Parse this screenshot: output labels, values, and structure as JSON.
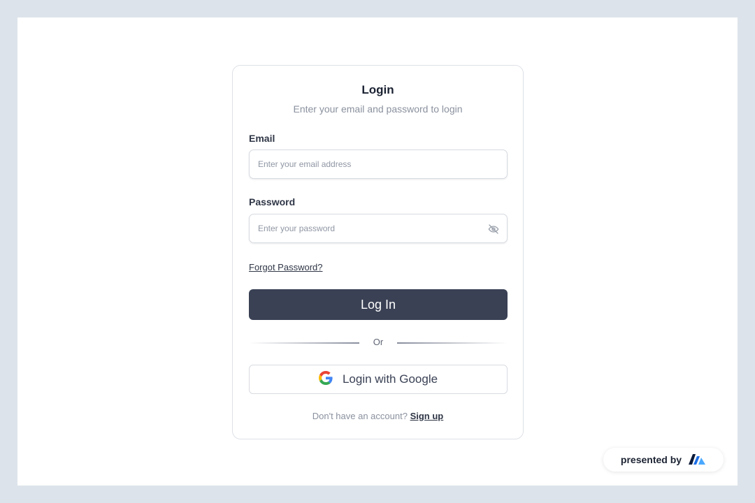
{
  "login_card": {
    "title": "Login",
    "subtitle": "Enter your email and password to login",
    "email": {
      "label": "Email",
      "placeholder": "Enter your email address",
      "value": ""
    },
    "password": {
      "label": "Password",
      "placeholder": "Enter your password",
      "value": "",
      "toggle_icon": "eye-off-icon"
    },
    "forgot_password": "Forgot Password?",
    "login_button": "Log In",
    "divider_text": "Or",
    "google_button": {
      "label": "Login with Google",
      "icon": "google-icon"
    },
    "signup_prompt": "Don't have an account?",
    "signup_link": "Sign up"
  },
  "badge": {
    "label": "presented by",
    "logo_icon": "brand-logo-icon"
  },
  "colors": {
    "page_background": "#dde3ea",
    "primary_button": "#3a4155",
    "muted_text": "#8a919e",
    "border": "#d7dbe1"
  }
}
